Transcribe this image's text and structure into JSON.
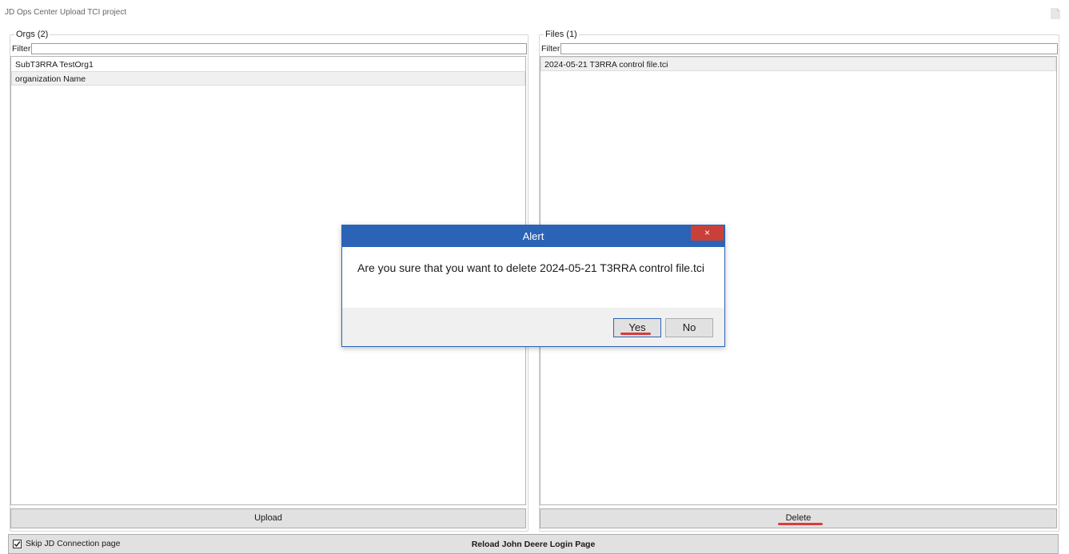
{
  "window": {
    "title": "JD Ops Center Upload TCI project"
  },
  "orgs": {
    "group_label": "Orgs (2)",
    "filter_label": "Filter",
    "filter_value": "",
    "items": [
      {
        "label": "SubT3RRA TestOrg1"
      },
      {
        "label": "organization Name"
      }
    ],
    "button_label": "Upload"
  },
  "files": {
    "group_label": "Files (1)",
    "filter_label": "Filter",
    "filter_value": "",
    "items": [
      {
        "label": "2024-05-21 T3RRA control file.tci"
      }
    ],
    "button_label": "Delete"
  },
  "bottom": {
    "skip_label": "Skip JD Connection page",
    "skip_checked": true,
    "reload_label": "Reload John Deere Login Page"
  },
  "dialog": {
    "title": "Alert",
    "close_glyph": "×",
    "message": "Are you sure that you want to delete 2024-05-21 T3RRA control file.tci",
    "yes_label": "Yes",
    "no_label": "No"
  },
  "colors": {
    "dialog_accent": "#2b63b6",
    "close_red": "#c9403a",
    "annotation_red": "#d93c3c"
  },
  "icons": {
    "corner": "document-icon",
    "checkbox": "checkmark-icon"
  }
}
